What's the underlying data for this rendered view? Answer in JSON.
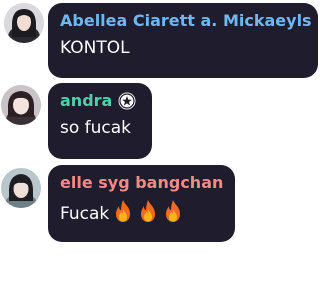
{
  "messages": [
    {
      "author": "Abellea Ciarett a. Mickaeyls",
      "author_color": "#6fb7f0",
      "text": "KONTOL",
      "avatar": "avatar-dark-hair-icon"
    },
    {
      "author": "andra",
      "author_color": "#4fd0a8",
      "text": "so fucak",
      "avatar": "avatar-light-hair-icon",
      "badge": "star-badge-icon"
    },
    {
      "author": "elle syg bangchan",
      "author_color": "#f08a86",
      "text": "Fucak",
      "avatar": "avatar-bangs-icon",
      "emoji": "fire-icon",
      "emoji_count": 3
    }
  ],
  "colors": {
    "bubble": "#1f1c2e",
    "text": "#ffffff",
    "background": "#ffffff"
  }
}
